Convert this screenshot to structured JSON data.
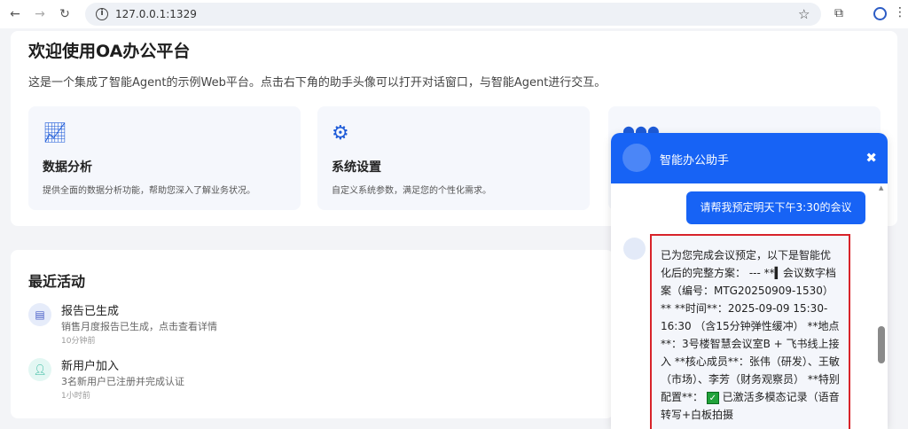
{
  "browser": {
    "url": "127.0.0.1:1329"
  },
  "welcome": {
    "title": "欢迎使用OA办公平台",
    "description": "这是一个集成了智能Agent的示例Web平台。点击右下角的助手头像可以打开对话窗口，与智能Agent进行交互。",
    "features": [
      {
        "icon": "chart-line-icon",
        "title": "数据分析",
        "desc": "提供全面的数据分析功能，帮助您深入了解业务状况。"
      },
      {
        "icon": "gear-icon",
        "title": "系统设置",
        "desc": "自定义系统参数，满足您的个性化需求。"
      },
      {
        "icon": "users-icon",
        "title": "",
        "desc": ""
      }
    ]
  },
  "activity": {
    "title": "最近活动",
    "items": [
      {
        "icon": "document-icon",
        "title": "报告已生成",
        "subtitle": "销售月度报告已生成，点击查看详情",
        "time": "10分钟前",
        "color": "#e6ecfa"
      },
      {
        "icon": "user-plus-icon",
        "title": "新用户加入",
        "subtitle": "3名新用户已注册并完成认证",
        "time": "1小时前",
        "color": "#e3f7f3"
      }
    ]
  },
  "chat": {
    "title": "智能办公助手",
    "user_message": "请帮我预定明天下午3:30的会议",
    "bot_message_a": "已为您完成会议预定，以下是智能优化后的完整方案： --- **▍会议数字档案（编号：MTG20250909-1530）** **时间**：2025-09-09 15:30-16:30 （含15分钟弹性缓冲） **地点**：3号楼智慧会议室B + 飞书线上接入 **核心成员**：张伟（研发）、王敏（市场）、李芳（财务观察员） **特别配置**：",
    "bot_message_b": "已激活多模态记录（语音转写+白板拍摄",
    "accent": "#1763f5",
    "highlight_border": "#d8232a"
  }
}
